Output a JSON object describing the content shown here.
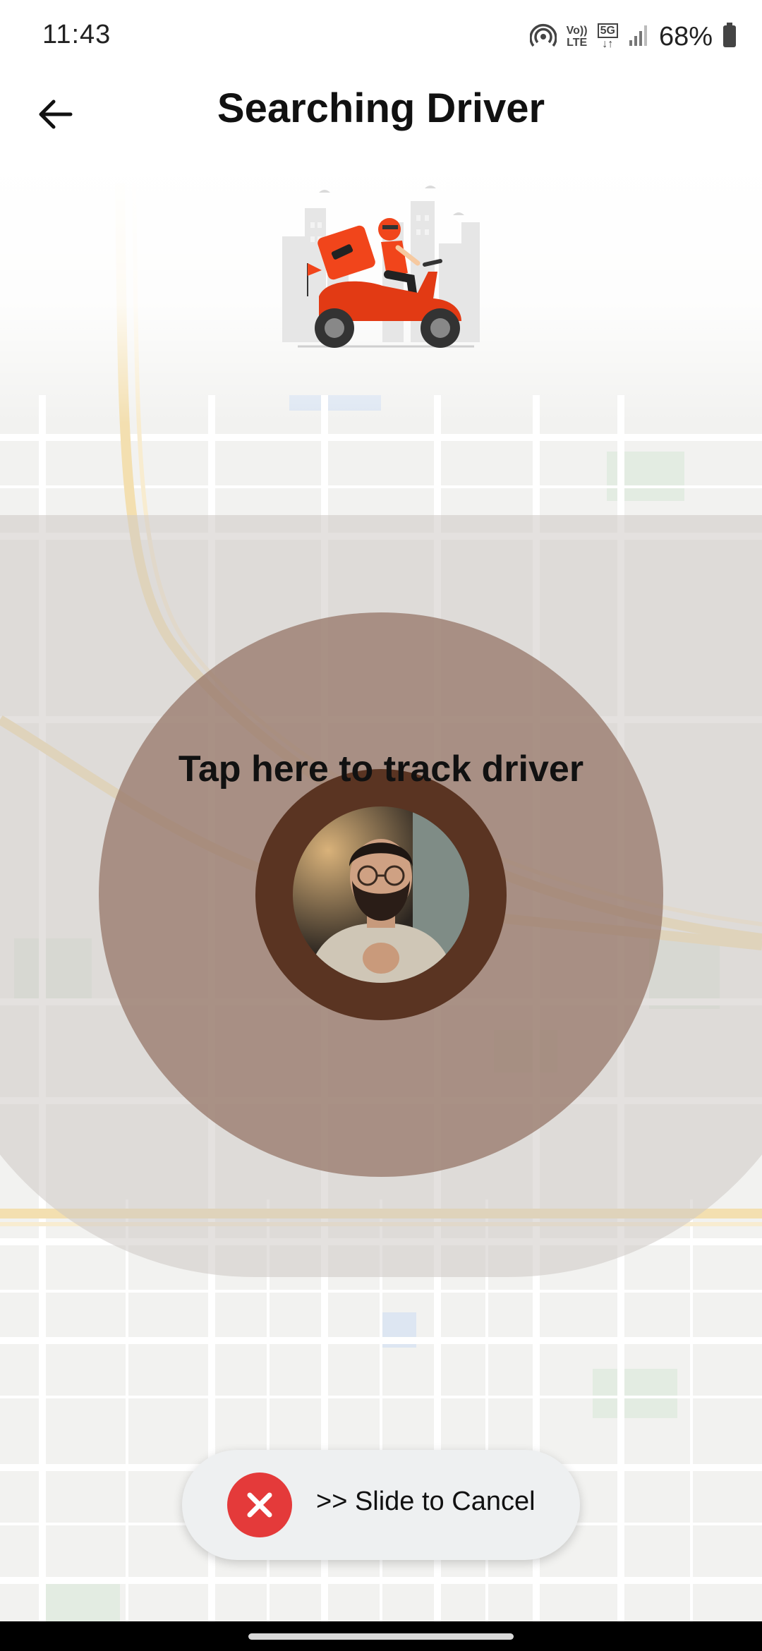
{
  "status_bar": {
    "time": "11:43",
    "volte_top": "Vo))",
    "volte_bottom": "LTE",
    "network_top": "5G",
    "network_bottom": "↓↑",
    "battery_percent": "68%",
    "icons": [
      "hotspot-icon",
      "volte-icon",
      "5g-icon",
      "signal-icon",
      "battery-icon"
    ]
  },
  "header": {
    "title": "Searching Driver",
    "back_icon": "arrow-left-icon"
  },
  "main": {
    "illustration": "delivery-scooter-illustration",
    "track_driver_text": "Tap here to track driver",
    "driver_avatar": "driver-avatar"
  },
  "slider": {
    "label": ">> Slide to Cancel",
    "handle_icon": "close-icon"
  },
  "colors": {
    "accent_red": "#e43a3a",
    "radar_outer": "#cdc8c4",
    "radar_middle": "#987a6b",
    "radar_inner": "#5a3422",
    "scooter_orange": "#f1451b"
  }
}
